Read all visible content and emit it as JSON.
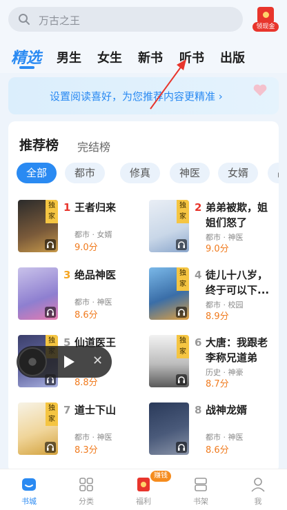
{
  "search": {
    "placeholder": "万古之王",
    "reward_label": "领现金"
  },
  "tabs": [
    "精选",
    "男生",
    "女生",
    "新书",
    "听书",
    "出版"
  ],
  "banner": {
    "text": "设置阅读喜好，为您推荐内容更精准 ›"
  },
  "ranking": {
    "tabs": [
      "推荐榜",
      "完结榜"
    ],
    "chips": [
      "全部",
      "都市",
      "修真",
      "神医",
      "女婿",
      "战"
    ],
    "exclusive_label": "独家",
    "books": [
      {
        "rank": "1",
        "title": "王者归来",
        "meta": "都市 · 女婿",
        "score": "9.0分",
        "exclusive": true
      },
      {
        "rank": "2",
        "title": "弟弟被欺，姐姐们怒了",
        "meta": "都市 · 神医",
        "score": "9.0分",
        "exclusive": true
      },
      {
        "rank": "3",
        "title": "绝品神医",
        "meta": "都市 · 神医",
        "score": "8.6分",
        "exclusive": false
      },
      {
        "rank": "4",
        "title": "徒儿十八岁，终于可以下...",
        "meta": "都市 · 校园",
        "score": "8.9分",
        "exclusive": true
      },
      {
        "rank": "5",
        "title": "仙道医王",
        "meta": "",
        "score": "8.8分",
        "exclusive": true
      },
      {
        "rank": "6",
        "title": "大唐：我跟老李称兄道弟",
        "meta": "历史 · 神豪",
        "score": "8.7分",
        "exclusive": true
      },
      {
        "rank": "7",
        "title": "道士下山",
        "meta": "都市 · 神医",
        "score": "8.3分",
        "exclusive": true
      },
      {
        "rank": "8",
        "title": "战神龙婿",
        "meta": "都市 · 神医",
        "score": "8.6分",
        "exclusive": false
      }
    ]
  },
  "bottom_nav": [
    {
      "label": "书城",
      "icon": "bookstore-icon"
    },
    {
      "label": "分类",
      "icon": "category-icon"
    },
    {
      "label": "福利",
      "icon": "gift-icon"
    },
    {
      "label": "书架",
      "icon": "bookshelf-icon"
    },
    {
      "label": "我",
      "icon": "profile-icon"
    }
  ],
  "earn_badge": "赚钱",
  "colors": {
    "accent": "#2a8af2",
    "score": "#f07a1d",
    "rank_top": "#e8352c",
    "rank_mid": "#f5a623",
    "rank_other": "#999999"
  }
}
